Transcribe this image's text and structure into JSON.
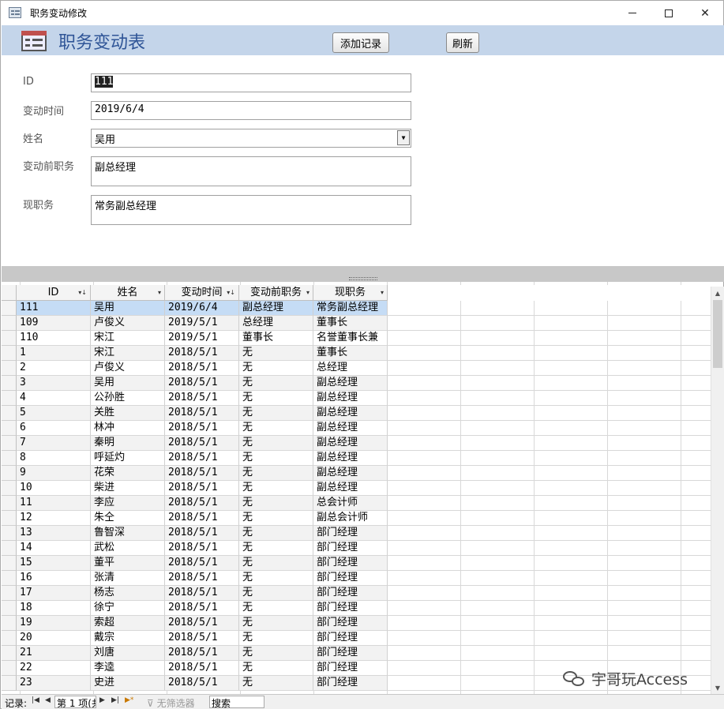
{
  "window": {
    "title": "职务变动修改"
  },
  "header": {
    "form_title": "职务变动表",
    "add_button": "添加记录",
    "refresh_button": "刷新"
  },
  "form": {
    "fields": [
      {
        "label": "ID",
        "value": "111"
      },
      {
        "label": "变动时间",
        "value": "2019/6/4"
      },
      {
        "label": "姓名",
        "value": "吴用"
      },
      {
        "label": "变动前职务",
        "value": "副总经理"
      },
      {
        "label": "现职务",
        "value": "常务副总经理"
      }
    ]
  },
  "datasheet": {
    "columns": [
      "ID",
      "姓名",
      "变动时间",
      "变动前职务",
      "现职务"
    ],
    "rows": [
      [
        "111",
        "吴用",
        "2019/6/4",
        "副总经理",
        "常务副总经理"
      ],
      [
        "109",
        "卢俊义",
        "2019/5/1",
        "总经理",
        "董事长"
      ],
      [
        "110",
        "宋江",
        "2019/5/1",
        "董事长",
        "名誉董事长兼"
      ],
      [
        "1",
        "宋江",
        "2018/5/1",
        "无",
        "董事长"
      ],
      [
        "2",
        "卢俊义",
        "2018/5/1",
        "无",
        "总经理"
      ],
      [
        "3",
        "吴用",
        "2018/5/1",
        "无",
        "副总经理"
      ],
      [
        "4",
        "公孙胜",
        "2018/5/1",
        "无",
        "副总经理"
      ],
      [
        "5",
        "关胜",
        "2018/5/1",
        "无",
        "副总经理"
      ],
      [
        "6",
        "林冲",
        "2018/5/1",
        "无",
        "副总经理"
      ],
      [
        "7",
        "秦明",
        "2018/5/1",
        "无",
        "副总经理"
      ],
      [
        "8",
        "呼延灼",
        "2018/5/1",
        "无",
        "副总经理"
      ],
      [
        "9",
        "花荣",
        "2018/5/1",
        "无",
        "副总经理"
      ],
      [
        "10",
        "柴进",
        "2018/5/1",
        "无",
        "副总经理"
      ],
      [
        "11",
        "李应",
        "2018/5/1",
        "无",
        "总会计师"
      ],
      [
        "12",
        "朱仝",
        "2018/5/1",
        "无",
        "副总会计师"
      ],
      [
        "13",
        "鲁智深",
        "2018/5/1",
        "无",
        "部门经理"
      ],
      [
        "14",
        "武松",
        "2018/5/1",
        "无",
        "部门经理"
      ],
      [
        "15",
        "董平",
        "2018/5/1",
        "无",
        "部门经理"
      ],
      [
        "16",
        "张清",
        "2018/5/1",
        "无",
        "部门经理"
      ],
      [
        "17",
        "杨志",
        "2018/5/1",
        "无",
        "部门经理"
      ],
      [
        "18",
        "徐宁",
        "2018/5/1",
        "无",
        "部门经理"
      ],
      [
        "19",
        "索超",
        "2018/5/1",
        "无",
        "部门经理"
      ],
      [
        "20",
        "戴宗",
        "2018/5/1",
        "无",
        "部门经理"
      ],
      [
        "21",
        "刘唐",
        "2018/5/1",
        "无",
        "部门经理"
      ],
      [
        "22",
        "李逵",
        "2018/5/1",
        "无",
        "部门经理"
      ],
      [
        "23",
        "史进",
        "2018/5/1",
        "无",
        "部门经理"
      ]
    ]
  },
  "navbar": {
    "label": "记录:",
    "record_text": "第 1 项(共",
    "filter_text": "无筛选器",
    "search_text": "搜索"
  },
  "watermark": {
    "text": "宇哥玩Access"
  },
  "colors": {
    "header_bg": "#c4d5ea",
    "title_color": "#2f5597",
    "selected_row": "#c5dcf5"
  }
}
